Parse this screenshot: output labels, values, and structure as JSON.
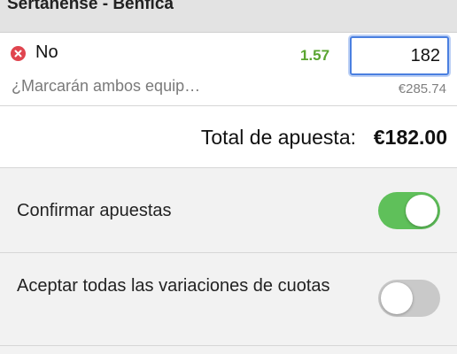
{
  "event": {
    "title": "Sertanense - Benfica"
  },
  "bet": {
    "selection": "No",
    "market": "¿Marcarán ambos equip…",
    "odds": "1.57",
    "stake": "182",
    "potential_return": "€285.74",
    "remove_icon": "close-circle-icon",
    "colors": {
      "odds": "#5aa531",
      "remove": "#e0454f",
      "input_focus": "#4a7fe0"
    }
  },
  "total": {
    "label": "Total de apuesta:",
    "value": "€182.00"
  },
  "settings": {
    "confirm_bets": {
      "label": "Confirmar apuestas",
      "enabled": true
    },
    "accept_odds_changes": {
      "label": "Aceptar todas las variaciones de cuotas",
      "enabled": false
    },
    "colors": {
      "toggle_on": "#5fc05a",
      "toggle_off": "#c9c9c9"
    }
  }
}
